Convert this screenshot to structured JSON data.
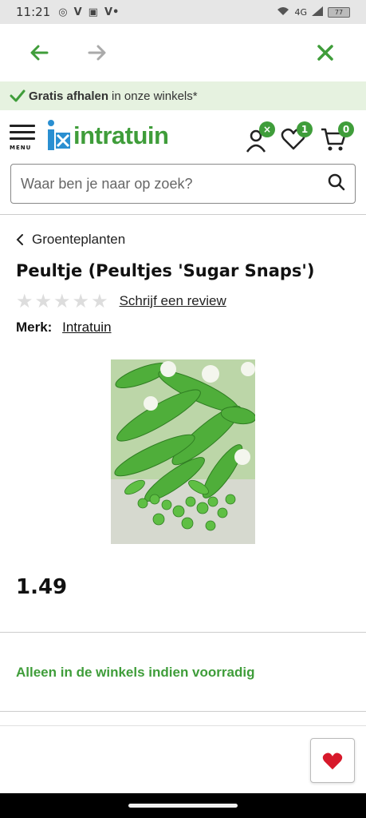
{
  "status_bar": {
    "time": "11:21",
    "network": "4G",
    "battery": "77"
  },
  "browser_nav": {
    "back_icon": "arrow-left-icon",
    "forward_icon": "arrow-right-icon",
    "close_icon": "close-icon"
  },
  "promo": {
    "bold": "Gratis afhalen",
    "rest": "in onze winkels*"
  },
  "header": {
    "menu_label": "MENU",
    "logo_text": "intratuin",
    "account_badge": "×",
    "wishlist_badge": "1",
    "cart_badge": "0"
  },
  "search": {
    "placeholder": "Waar ben je naar op zoek?"
  },
  "product": {
    "breadcrumb": "Groenteplanten",
    "title": "Peultje (Peultjes 'Sugar Snaps')",
    "rating": 0,
    "rating_max": 5,
    "review_link": "Schrijf een review",
    "brand_label": "Merk:",
    "brand_value": "Intratuin",
    "price": "1.49",
    "stock_note": "Alleen in de winkels indien voorradig"
  },
  "colors": {
    "brand_green": "#3f9d3a",
    "promo_bg": "#e6f2e0",
    "favorite_red": "#d7192b"
  }
}
